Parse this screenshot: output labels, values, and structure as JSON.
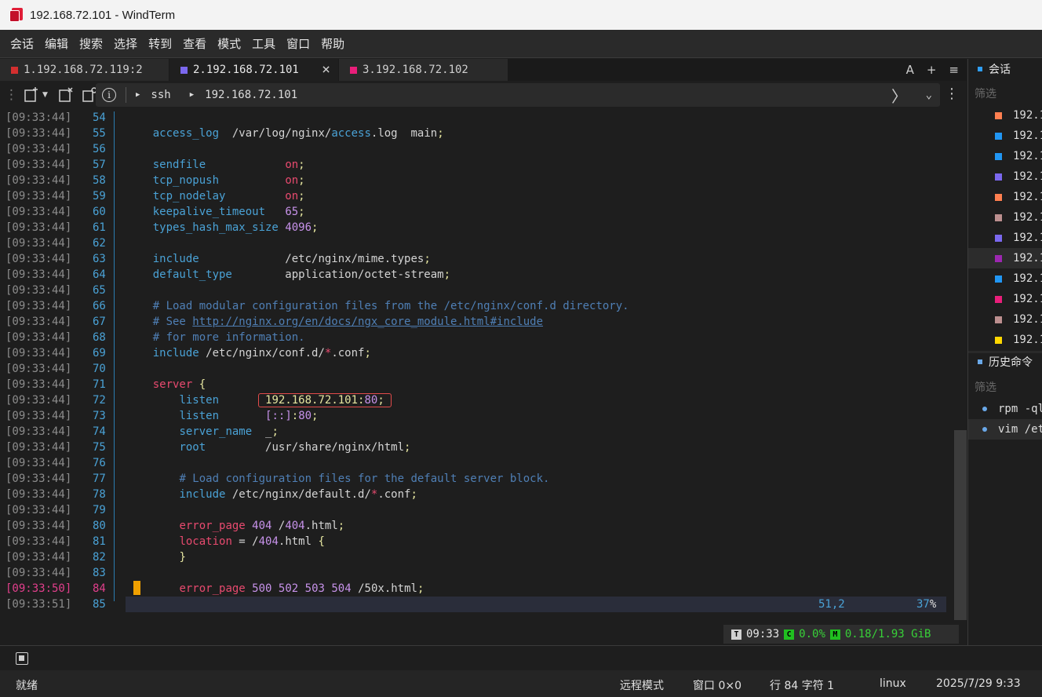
{
  "window": {
    "title": "192.168.72.101 - WindTerm"
  },
  "menu": [
    "会话",
    "编辑",
    "搜索",
    "选择",
    "转到",
    "查看",
    "模式",
    "工具",
    "窗口",
    "帮助"
  ],
  "tabs": [
    {
      "label": "1.192.168.72.119:2",
      "color": "#d32f2f",
      "active": false
    },
    {
      "label": "2.192.168.72.101",
      "color": "#7b68ee",
      "active": true
    },
    {
      "label": "3.192.168.72.102",
      "color": "#e91e7a",
      "active": false
    }
  ],
  "tab_tools": {
    "font": "A",
    "add": "+",
    "menu": "≡"
  },
  "address": {
    "protocol": "ssh",
    "host": "192.168.72.101"
  },
  "terminal": {
    "lines": [
      {
        "ts": "[09:33:44]",
        "ln": "54",
        "html": ""
      },
      {
        "ts": "[09:33:44]",
        "ln": "55",
        "html": "    <span class='kw'>access_log</span>  /var/log/nginx/<span class='kw'>access</span>.log  main<span class='yel'>;</span>"
      },
      {
        "ts": "[09:33:44]",
        "ln": "56",
        "html": ""
      },
      {
        "ts": "[09:33:44]",
        "ln": "57",
        "html": "    <span class='kw'>sendfile</span>            <span class='red'>on</span><span class='yel'>;</span>"
      },
      {
        "ts": "[09:33:44]",
        "ln": "58",
        "html": "    <span class='kw'>tcp_nopush</span>          <span class='red'>on</span><span class='yel'>;</span>"
      },
      {
        "ts": "[09:33:44]",
        "ln": "59",
        "html": "    <span class='kw'>tcp_nodelay</span>         <span class='red'>on</span><span class='yel'>;</span>"
      },
      {
        "ts": "[09:33:44]",
        "ln": "60",
        "html": "    <span class='kw'>keepalive_timeout</span>   <span class='purple'>65</span><span class='yel'>;</span>"
      },
      {
        "ts": "[09:33:44]",
        "ln": "61",
        "html": "    <span class='kw'>types_hash_max_size</span> <span class='purple'>4096</span><span class='yel'>;</span>"
      },
      {
        "ts": "[09:33:44]",
        "ln": "62",
        "html": ""
      },
      {
        "ts": "[09:33:44]",
        "ln": "63",
        "html": "    <span class='kw'>include</span>             /etc/nginx/mime.types<span class='yel'>;</span>"
      },
      {
        "ts": "[09:33:44]",
        "ln": "64",
        "html": "    <span class='kw'>default_type</span>        application/octet-stream<span class='yel'>;</span>"
      },
      {
        "ts": "[09:33:44]",
        "ln": "65",
        "html": ""
      },
      {
        "ts": "[09:33:44]",
        "ln": "66",
        "html": "    <span class='cmt'># Load modular configuration files from the /etc/nginx/conf.d directory.</span>"
      },
      {
        "ts": "[09:33:44]",
        "ln": "67",
        "html": "    <span class='cmt'># See </span><span class='link'>http://nginx.org/en/docs/ngx_core_module.html#include</span>"
      },
      {
        "ts": "[09:33:44]",
        "ln": "68",
        "html": "    <span class='cmt'># for more information.</span>"
      },
      {
        "ts": "[09:33:44]",
        "ln": "69",
        "html": "    <span class='kw'>include</span> /etc/nginx/conf.d/<span class='red'>*</span>.conf<span class='yel'>;</span>"
      },
      {
        "ts": "[09:33:44]",
        "ln": "70",
        "html": ""
      },
      {
        "ts": "[09:33:44]",
        "ln": "71",
        "html": "    <span class='red'>server</span> <span class='yel'>{</span>"
      },
      {
        "ts": "[09:33:44]",
        "ln": "72",
        "html": "        <span class='kw'>listen</span>       <span class='hl-box'><span class='yel'>192.168.72.101:</span><span class='purple'>80</span><span class='yel'>;</span></span>"
      },
      {
        "ts": "[09:33:44]",
        "ln": "73",
        "html": "        <span class='kw'>listen</span>       <span class='purple'>[::]</span><span class='yel'>:</span><span class='purple'>80</span><span class='yel'>;</span>"
      },
      {
        "ts": "[09:33:44]",
        "ln": "74",
        "html": "        <span class='kw'>server_name</span>  _<span class='yel'>;</span>"
      },
      {
        "ts": "[09:33:44]",
        "ln": "75",
        "html": "        <span class='kw'>root</span>         /usr/share/nginx/html<span class='yel'>;</span>"
      },
      {
        "ts": "[09:33:44]",
        "ln": "76",
        "html": ""
      },
      {
        "ts": "[09:33:44]",
        "ln": "77",
        "html": "        <span class='cmt'># Load configuration files for the default server block.</span>"
      },
      {
        "ts": "[09:33:44]",
        "ln": "78",
        "html": "        <span class='kw'>include</span> /etc/nginx/default.d/<span class='red'>*</span>.conf<span class='yel'>;</span>"
      },
      {
        "ts": "[09:33:44]",
        "ln": "79",
        "html": ""
      },
      {
        "ts": "[09:33:44]",
        "ln": "80",
        "html": "        <span class='red'>error_page</span> <span class='purple'>404</span> /<span class='purple'>404</span>.html<span class='yel'>;</span>"
      },
      {
        "ts": "[09:33:44]",
        "ln": "81",
        "html": "        <span class='red'>location</span> = /<span class='purple'>404</span>.html <span class='yel'>{</span>"
      },
      {
        "ts": "[09:33:44]",
        "ln": "82",
        "html": "        <span class='yel'>}</span>"
      },
      {
        "ts": "[09:33:44]",
        "ln": "83",
        "html": ""
      },
      {
        "ts": "[09:33:50]",
        "ln": "84",
        "html": "        <span class='red'>error_page</span> <span class='purple'>500</span> <span class='purple'>502</span> <span class='purple'>503</span> <span class='purple'>504</span> /50x.html<span class='yel'>;</span>",
        "current": true
      },
      {
        "ts": "[09:33:51]",
        "ln": "85",
        "html": ""
      }
    ],
    "cursor_pos": "51,2",
    "scroll_percent": "37",
    "percent_sign": "%"
  },
  "monitor": {
    "time": "09:33",
    "cpu": "0.0%",
    "mem": "0.18/1.93 GiB",
    "t_badge": "T",
    "c_badge": "C",
    "m_badge": "M"
  },
  "status": {
    "ready": "就绪",
    "remote_mode": "远程模式",
    "window": "窗口 0×0",
    "row_col": "行 84 字符 1",
    "os": "linux",
    "datetime": "2025/7/29 9:33"
  },
  "sidebar": {
    "sessions_title": "会话",
    "filter_placeholder": "筛选",
    "sessions": [
      {
        "label": "192.1",
        "color": "#ff7f50"
      },
      {
        "label": "192.1",
        "color": "#2196f3"
      },
      {
        "label": "192.1",
        "color": "#2196f3"
      },
      {
        "label": "192.1",
        "color": "#7b68ee"
      },
      {
        "label": "192.1",
        "color": "#ff7f50"
      },
      {
        "label": "192.1",
        "color": "#bc8f8f"
      },
      {
        "label": "192.1",
        "color": "#7b68ee"
      },
      {
        "label": "192.1",
        "color": "#9c27b0",
        "selected": true
      },
      {
        "label": "192.1",
        "color": "#2196f3"
      },
      {
        "label": "192.1",
        "color": "#e91e7a"
      },
      {
        "label": "192.1",
        "color": "#bc8f8f"
      },
      {
        "label": "192.1",
        "color": "#ffd700"
      }
    ],
    "history_title": "历史命令",
    "history": [
      {
        "label": "rpm -ql"
      },
      {
        "label": "vim /et",
        "selected": true
      }
    ]
  }
}
